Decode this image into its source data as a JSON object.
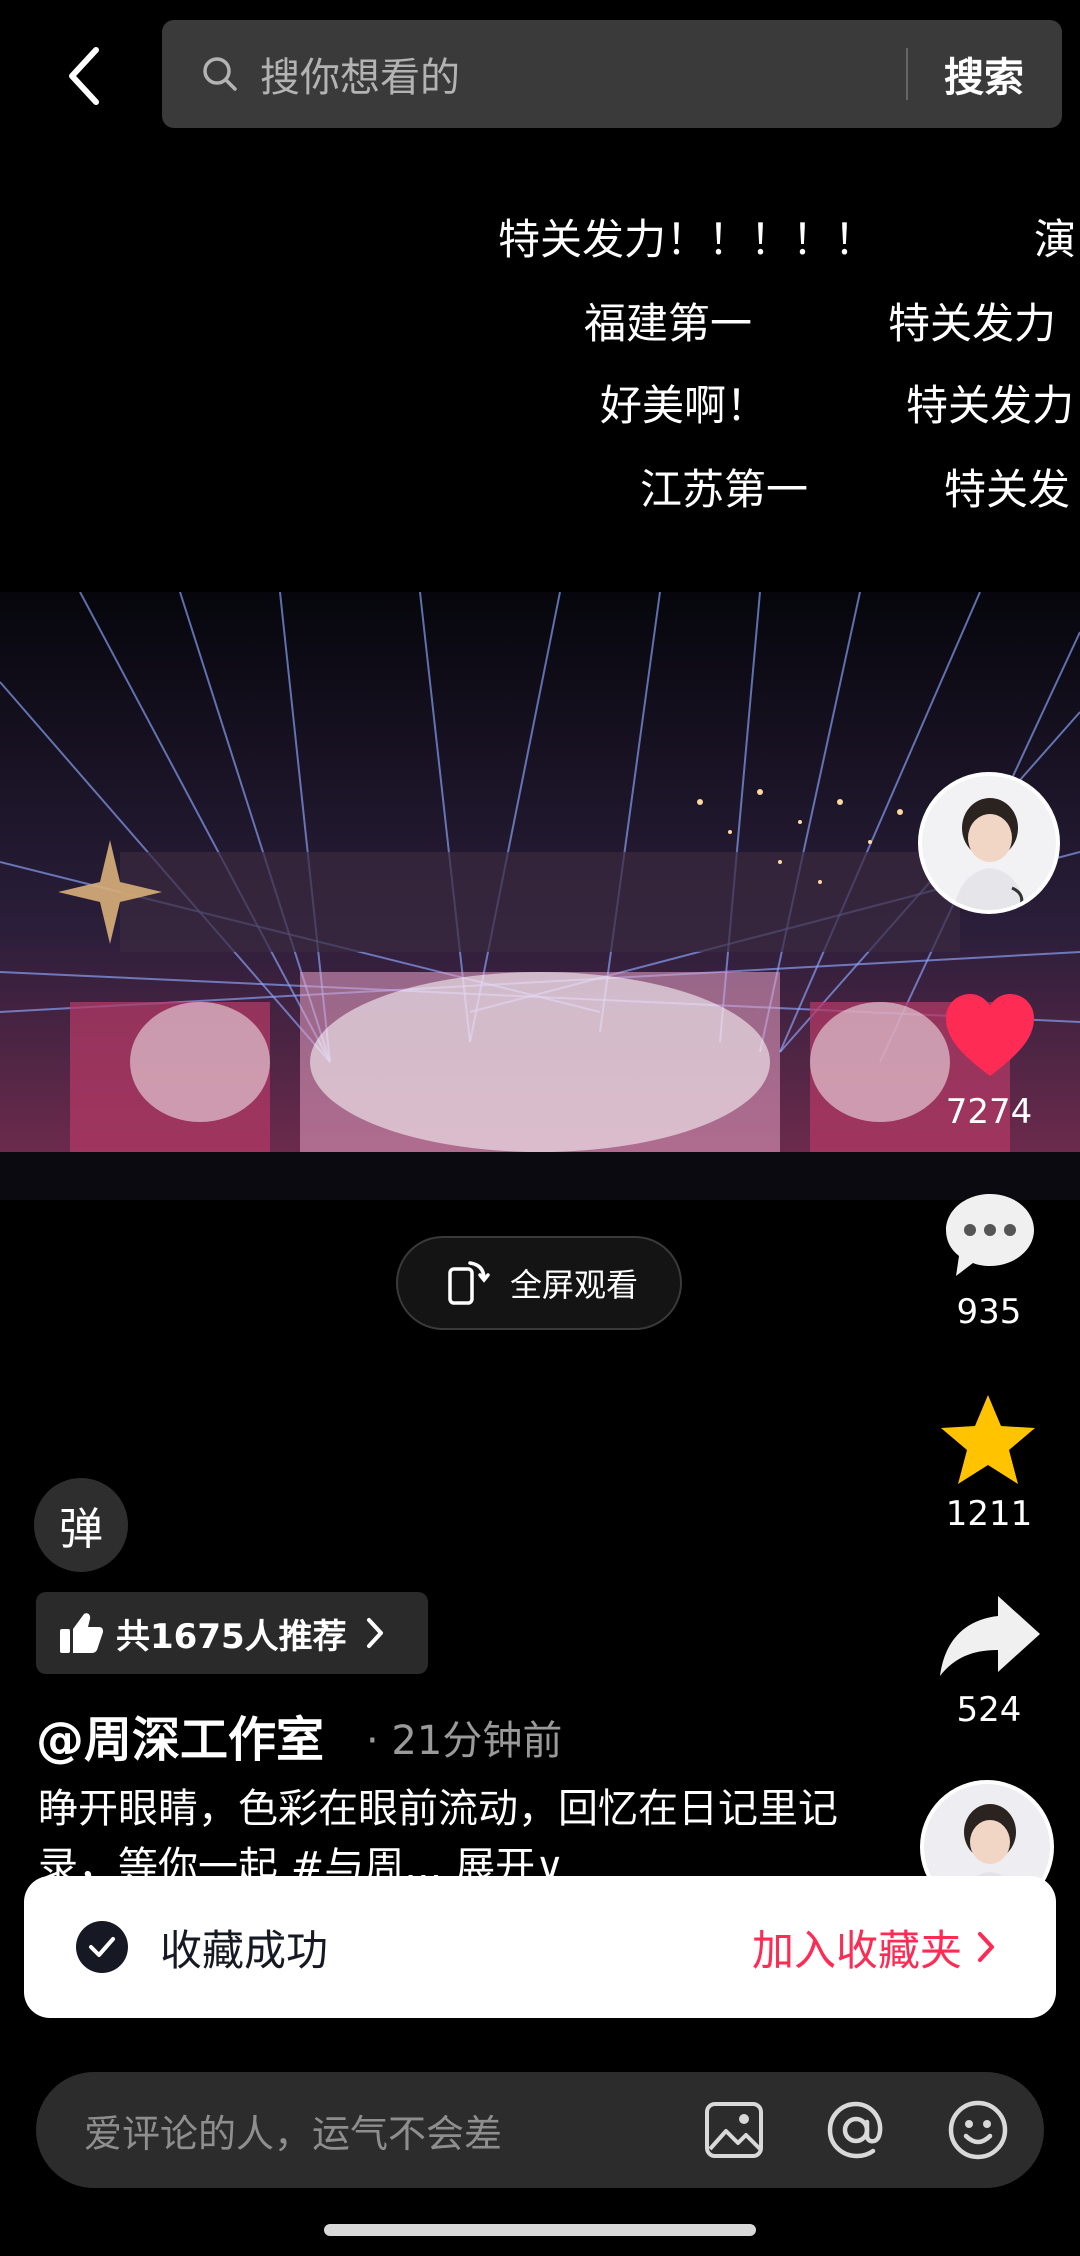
{
  "search": {
    "placeholder": "搜你想看的",
    "button_label": "搜索"
  },
  "danmaku": [
    "特关发力！！！！！",
    "演",
    "福建第一",
    "特关发力",
    "好美啊！",
    "特关发力",
    "江苏第一",
    "特关发"
  ],
  "video": {
    "fullscreen_label": "全屏观看"
  },
  "actions": {
    "like_count": "7274",
    "comment_count": "935",
    "favorite_count": "1211",
    "share_count": "524"
  },
  "danmaku_toggle_label": "弹",
  "recommend": {
    "label": "共1675人推荐"
  },
  "post": {
    "author": "@周深工作室",
    "time": "· 21分钟前",
    "description": "睁开眼睛，色彩在眼前流动，回忆在日记里记录，等你一起 #与周... 展开∨"
  },
  "toast": {
    "message": "收藏成功",
    "action_label": "加入收藏夹"
  },
  "comment_bar": {
    "placeholder": "爱评论的人，运气不会差"
  },
  "colors": {
    "accent_red": "#fe2c55",
    "like_red": "#fe2c55",
    "star_yellow": "#ffc300"
  }
}
